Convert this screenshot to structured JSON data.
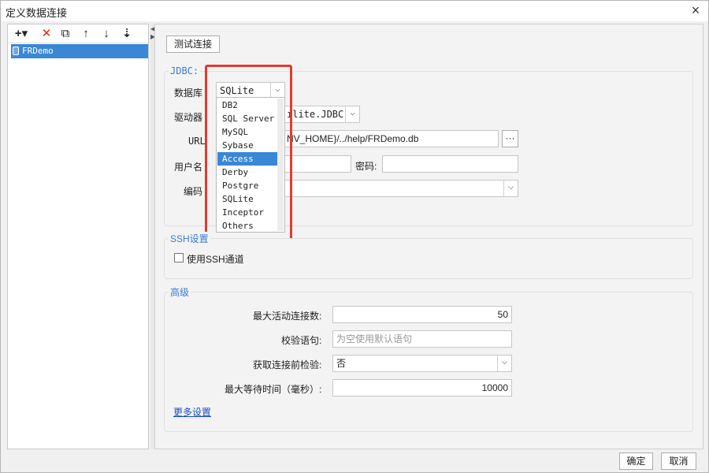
{
  "window": {
    "title": "定义数据连接",
    "close_icon": "×"
  },
  "toolbar": {
    "add_icon": "+▾",
    "delete_icon": "✕",
    "copy_icon": "⧉",
    "up_icon": "↑",
    "down_icon": "↓",
    "sort_icon": "⇣"
  },
  "tree": {
    "items": [
      {
        "label": "FRDemo"
      }
    ]
  },
  "actions": {
    "test_connection": "测试连接"
  },
  "jdbc": {
    "section_title": "JDBC:",
    "db_label": "数据库",
    "db_value": "SQLite",
    "driver_label": "驱动器",
    "driver_value": "ılite.JDBC",
    "url_label": "URL",
    "url_value": "NV_HOME}/../help/FRDemo.db",
    "url_more_icon": "···",
    "username_label": "用户名",
    "username_value": "",
    "password_label": "密码:",
    "password_value": "",
    "encoding_label": "编码",
    "encoding_value": ""
  },
  "db_dropdown": {
    "options": [
      "DB2",
      "SQL Server",
      "MySQL",
      "Sybase",
      "Access",
      "Derby",
      "Postgre",
      "SQLite",
      "Inceptor",
      "Others"
    ],
    "highlighted": "Access"
  },
  "ssh": {
    "section_title": "SSH设置",
    "use_ssh_label": "使用SSH通道",
    "use_ssh_checked": false
  },
  "advanced": {
    "section_title": "高级",
    "max_active_label": "最大活动连接数:",
    "max_active_value": "50",
    "validation_label": "校验语句:",
    "validation_placeholder": "为空使用默认语句",
    "test_before_label": "获取连接前检验:",
    "test_before_value": "否",
    "max_wait_label": "最大等待时间（毫秒）:",
    "max_wait_value": "10000",
    "more_settings": "更多设置"
  },
  "footer": {
    "ok": "确定",
    "cancel": "取消"
  },
  "colors": {
    "accent": "#3a87d6",
    "section_title": "#3a7bd5",
    "highlight_box": "#e23b31"
  }
}
